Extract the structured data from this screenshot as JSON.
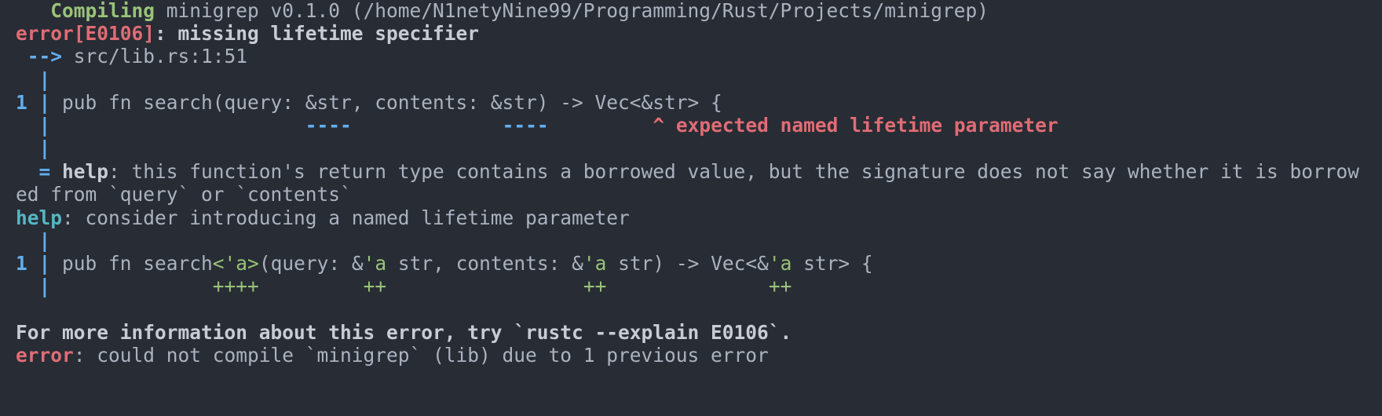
{
  "colors": {
    "background": "#282c34",
    "text": "#abb2bf",
    "green": "#98c379",
    "red": "#e06c75",
    "blue": "#61afef",
    "cyan": "#56b6c2"
  },
  "compile": {
    "indent": "   ",
    "status": "Compiling",
    "message": " minigrep v0.1.0 (/home/N1netyNine99/Programming/Rust/Projects/minigrep)"
  },
  "error": {
    "code_label": "error[E0106]",
    "message": ": missing lifetime specifier",
    "arrow": " -->",
    "location": " src/lib.rs:1:51",
    "gutter_pipe": "  |",
    "line_number": "1",
    "source_pipe": " | ",
    "source_code": "pub fn search(query: &str, contents: &str) -> Vec<&str> {",
    "underline_prefix": "  |",
    "underline_gap1": "                      ",
    "underline_dash1": "----",
    "underline_gap2": "             ",
    "underline_dash2": "----",
    "underline_gap3": "         ",
    "underline_label": "^ expected named lifetime parameter",
    "gutter_pipe2": "  |"
  },
  "help_note": {
    "eq": "  = ",
    "label": "help",
    "text_line1": ": this function's return type contains a borrowed value, but the signature does not say whether it is borrow",
    "text_line2": "ed from `query` or `contents`"
  },
  "help_suggestion": {
    "label": "help",
    "text": ": consider introducing a named lifetime parameter",
    "gutter_pipe": "  |",
    "line_number": "1",
    "source_pipe": " | ",
    "code_part1": "pub fn search",
    "code_lt1": "<'a>",
    "code_part2": "(query: &",
    "code_lt2": "'a",
    "code_part3": " str, contents: &",
    "code_lt3": "'a",
    "code_part4": " str) -> Vec<&",
    "code_lt4": "'a",
    "code_part5": " str> {",
    "added_prefix": "  |",
    "added_gap1": "              ",
    "added_plus1": "++++",
    "added_gap2": "         ",
    "added_plus2": "++",
    "added_gap3": "                 ",
    "added_plus3": "++",
    "added_gap4": "              ",
    "added_plus4": "++"
  },
  "footer": {
    "more_info": "For more information about this error, try `rustc --explain E0106`.",
    "error_label": "error",
    "error_text": ": could not compile `minigrep` (lib) due to 1 previous error"
  }
}
